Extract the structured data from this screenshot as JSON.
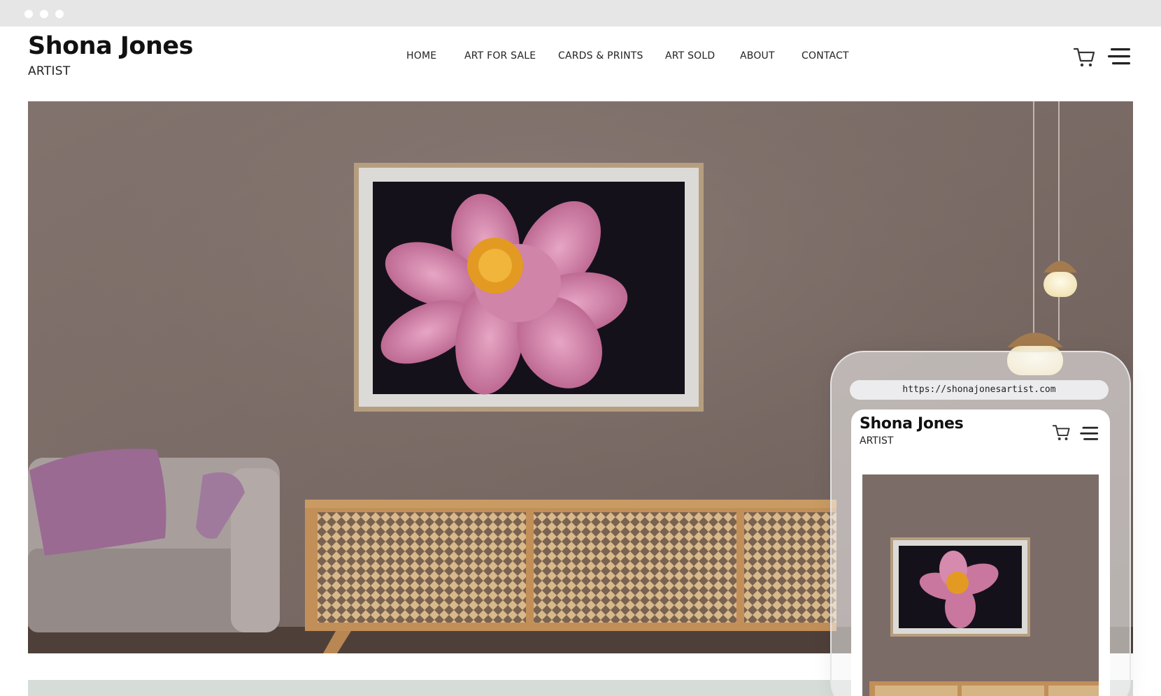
{
  "browser": {
    "dots": [
      "window-dot",
      "window-dot",
      "window-dot"
    ]
  },
  "site": {
    "brand_name": "Shona Jones",
    "brand_sub": "ARTIST",
    "nav": [
      {
        "label": "HOME"
      },
      {
        "label": "ART FOR SALE"
      },
      {
        "label": "CARDS & PRINTS"
      },
      {
        "label": "ART SOLD"
      },
      {
        "label": "ABOUT"
      },
      {
        "label": "CONTACT"
      }
    ],
    "icons": {
      "cart": "cart-icon",
      "menu": "hamburger-menu-icon"
    }
  },
  "hero": {
    "scene": [
      "wall",
      "framed-peony-painting",
      "armchair",
      "lavender-cushion",
      "sideboard",
      "pendant-lamps"
    ],
    "colors": {
      "wall": "#7b6c66",
      "frame": "#b8a181",
      "mat": "#dcdad7",
      "petal": "#c9779e",
      "center": "#e8a024",
      "wood": "#c79a62",
      "chair": "#a69d9b",
      "cushion": "#9c6c94"
    }
  },
  "mobile": {
    "url": "https://shonajonesartist.com",
    "brand_name": "Shona Jones",
    "brand_sub": "ARTIST"
  }
}
